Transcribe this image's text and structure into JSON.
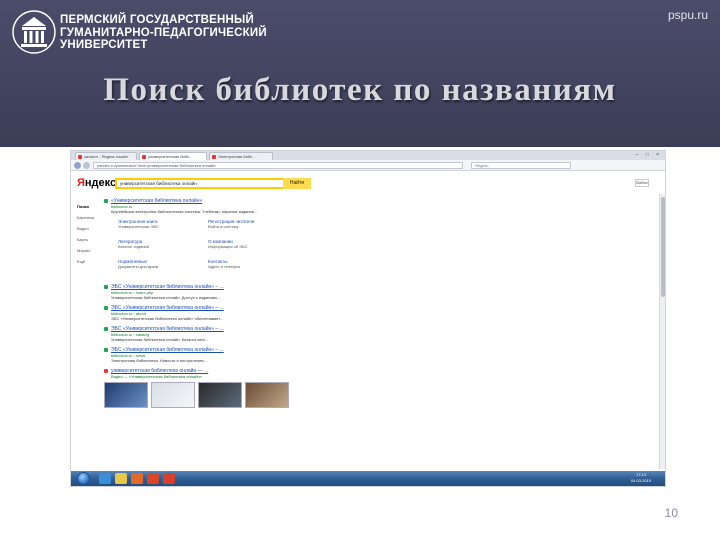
{
  "header": {
    "university_name_lines": [
      "ПЕРМСКИЙ ГОСУДАРСТВЕННЫЙ",
      "ГУМАНИТАРНО-ПЕДАГОГИЧЕСКИЙ",
      "УНИВЕРСИТЕТ"
    ],
    "site_link": "pspu.ru",
    "slide_title": "Поиск библиотек по названиям"
  },
  "page_number": "10",
  "browser": {
    "tabs": [
      {
        "label": "каталог - Яндекс нашёл",
        "active": false
      },
      {
        "label": "университетская библ...",
        "active": true
      },
      {
        "label": "Электронная библ...",
        "active": false
      }
    ],
    "window_buttons": "– □ ×",
    "url": "yandex.ru/yandsearch?text=университетская библиотека онлайн",
    "search_placeholder": "Яндекс",
    "yandex": {
      "logo_first": "Я",
      "logo_rest": "ндекс",
      "query": "университетская библиотека онлайн",
      "find_button": "Найти",
      "login": "Войти"
    },
    "left_nav": [
      "Поиск",
      "Картинки",
      "Видео",
      "Карты",
      "Маркет",
      "Ещё"
    ],
    "top_result": {
      "title": "«Университетская библиотека онлайн»",
      "url": "biblioclub.ru",
      "snippet": "Крупнейшая электронно-библиотечная система. Учебники, научные издания..."
    },
    "sitelinks": [
      {
        "title": "Электронная книга",
        "desc": "Университетская ЭБС"
      },
      {
        "title": "Регистрация читателя",
        "desc": "Войти в систему"
      },
      {
        "title": "Литература",
        "desc": "Каталог изданий"
      },
      {
        "title": "О компании",
        "desc": "Информация об ЭБС"
      },
      {
        "title": "Нормативные",
        "desc": "Документы для вузов"
      },
      {
        "title": "Контакты",
        "desc": "Адрес и телефон"
      }
    ],
    "results": [
      {
        "title": "ЭБС «Университетская библиотека онлайн» – ...",
        "url": "biblioclub.ru › index.php",
        "snippet": "Университетская библиотека онлайн. Доступ к изданиям..."
      },
      {
        "title": "ЭБС «Университетская библиотека онлайн» – ...",
        "url": "biblioclub.ru › about",
        "snippet": "ЭБС «Университетская библиотека онлайн» обеспечивает..."
      },
      {
        "title": "ЭБС «Университетская библиотека онлайн» – ...",
        "url": "biblioclub.ru › catalog",
        "snippet": "Университетская библиотека онлайн. Каталог книг..."
      },
      {
        "title": "ЭБС «Университетская библиотека онлайн» – ...",
        "url": "biblioclub.ru › news",
        "snippet": "Электронная библиотека. Новости и поступления..."
      }
    ],
    "video": {
      "title": "университетская библиотека онлайн — ...",
      "subtitle": "Видео — «Университетская библиотека онлайн»"
    },
    "clock": {
      "time": "17:14",
      "date": "04.03.2015"
    }
  },
  "colors": {
    "header_bg": "#3c3e58",
    "yandex_yellow": "#ffdb4d",
    "link_blue": "#1b4fb5",
    "url_green": "#0a7a2e"
  }
}
